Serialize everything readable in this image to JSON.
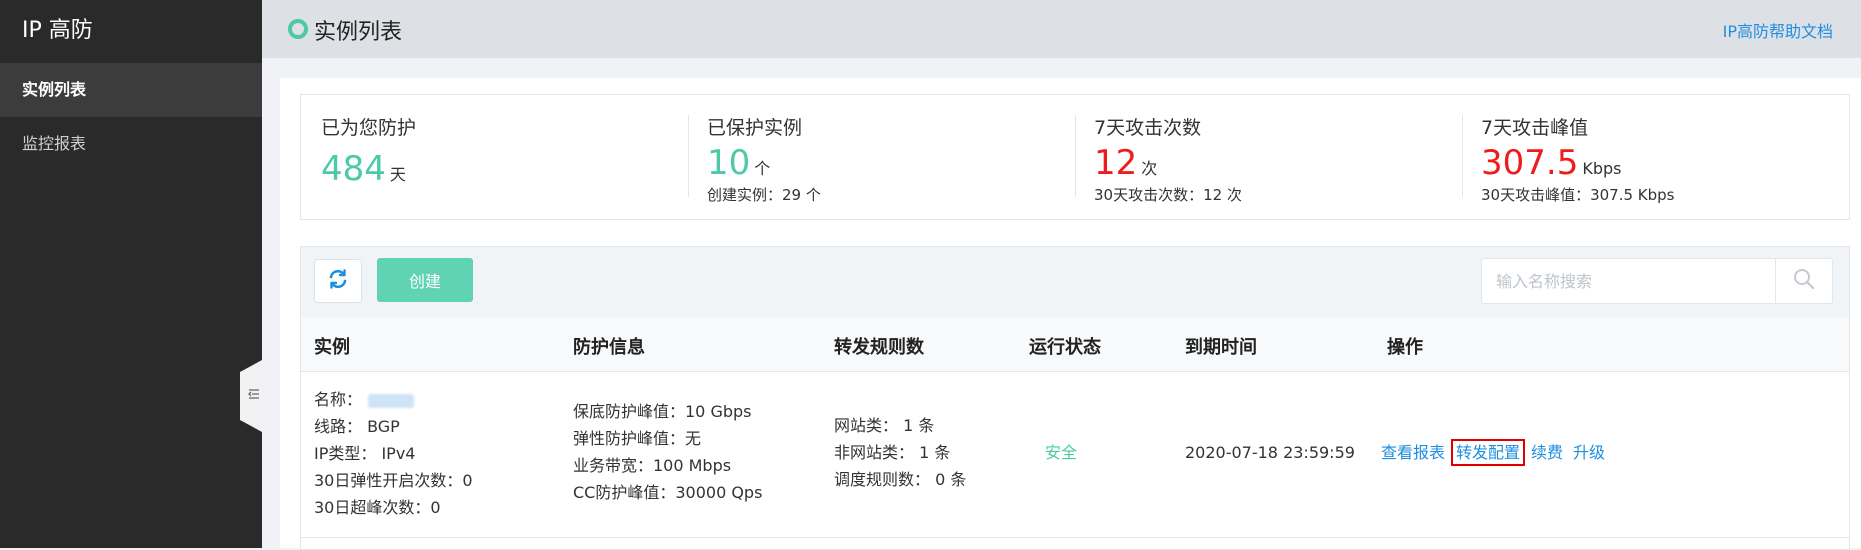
{
  "app": {
    "brand": "IP 高防"
  },
  "sidebar": {
    "items": [
      {
        "label": "实例列表",
        "active": true
      },
      {
        "label": "监控报表",
        "active": false
      }
    ],
    "collapse_icon": "collapse-left-icon"
  },
  "header": {
    "title": "实例列表",
    "help_link": "IP高防帮助文档"
  },
  "stats": [
    {
      "label": "已为您防护",
      "value": "484",
      "unit": "天",
      "sub": ""
    },
    {
      "label": "已保护实例",
      "value": "10",
      "unit": "个",
      "sub": "创建实例：29 个"
    },
    {
      "label": "7天攻击次数",
      "value": "12",
      "unit": "次",
      "sub": "30天攻击次数：12 次"
    },
    {
      "label": "7天攻击峰值",
      "value": "307.5",
      "unit": "Kbps",
      "sub": "30天攻击峰值：307.5 Kbps"
    }
  ],
  "toolbar": {
    "create_label": "创建",
    "search_placeholder": "输入名称搜索",
    "refresh_icon": "refresh-icon",
    "search_icon": "search-icon"
  },
  "table": {
    "headers": [
      "实例",
      "防护信息",
      "转发规则数",
      "运行状态",
      "到期时间",
      "操作"
    ],
    "rows": [
      {
        "instance": {
          "name_label": "名称：",
          "line": "线路：  BGP",
          "ip_type": "IP类型：  IPv4",
          "elastic_count": "30日弹性开启次数：0",
          "peak_exceed": "30日超峰次数：0"
        },
        "protection": {
          "base": "保底防护峰值：10 Gbps",
          "elastic": "弹性防护峰值：无",
          "bandwidth": "业务带宽：100 Mbps",
          "cc": "CC防护峰值：30000 Qps"
        },
        "rules": {
          "website": "网站类：  1 条",
          "non_website": "非网站类：  1 条",
          "schedule": "调度规则数：  0 条"
        },
        "status": "安全",
        "expire": "2020-07-18 23:59:59",
        "actions": [
          "查看报表",
          "转发配置",
          "续费",
          "升级"
        ]
      }
    ]
  },
  "colors": {
    "accent": "#4cc9a6",
    "danger": "#ee1d1d",
    "link": "#1e8ee0",
    "sidebar": "#2a2a2a"
  }
}
